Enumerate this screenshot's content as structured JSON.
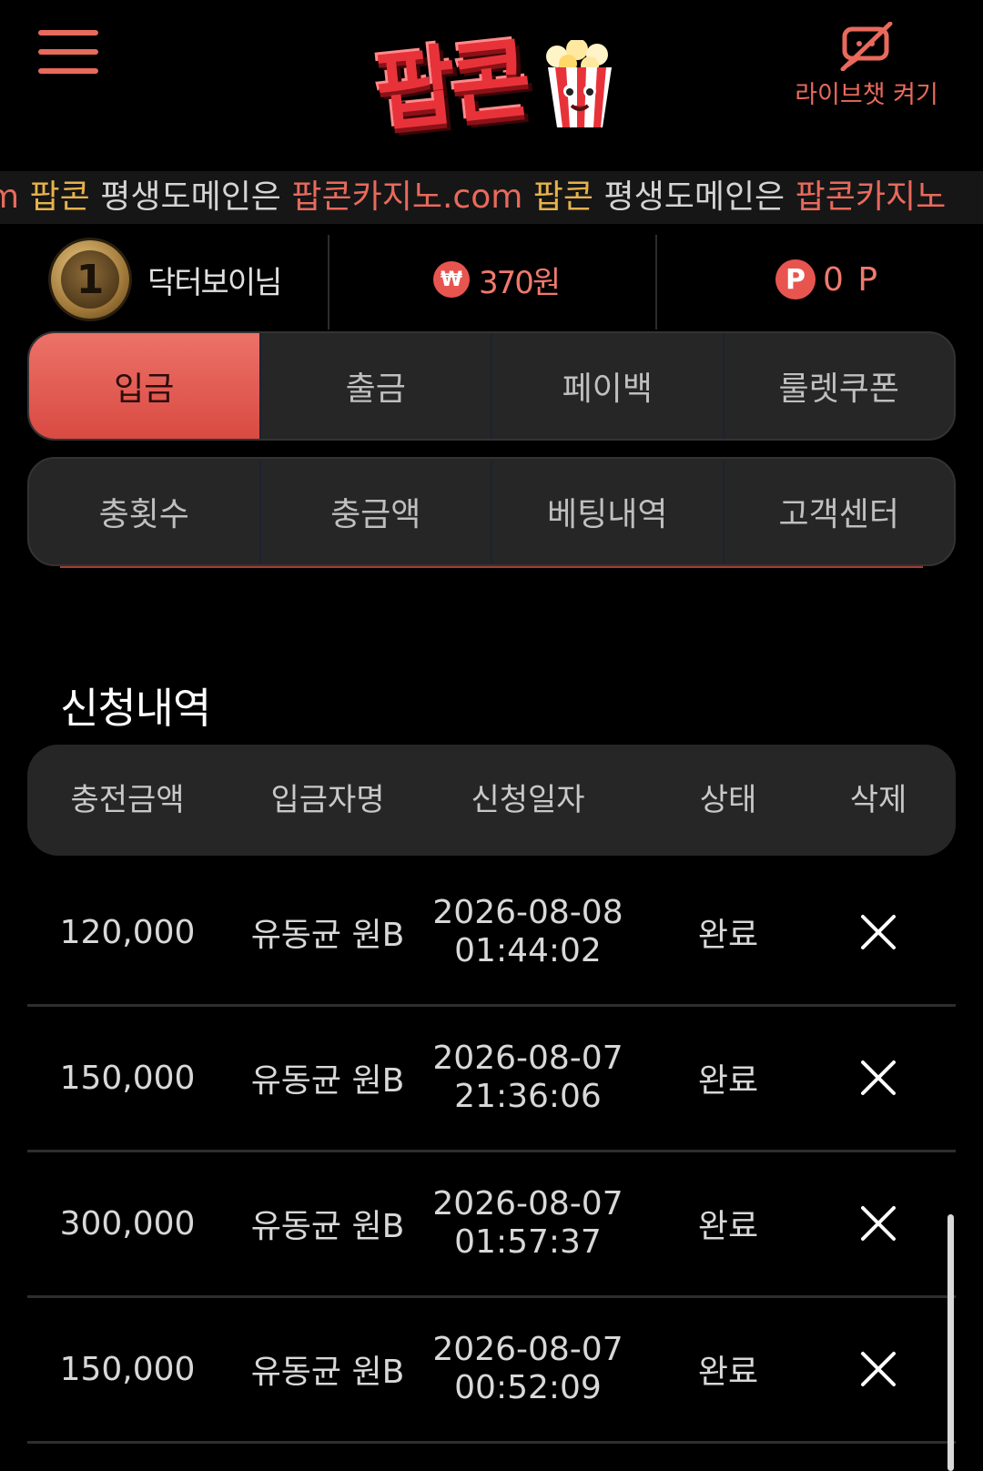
{
  "header": {
    "logo_text": "팝콘",
    "livechat_label": "라이브챗 켜기"
  },
  "marquee": {
    "segments": [
      {
        "text": "m ",
        "kind": "link"
      },
      {
        "text": "팝콘",
        "kind": "brand"
      },
      {
        "text": " 평생도메인은 ",
        "kind": "text"
      },
      {
        "text": "팝콘카지노.com",
        "kind": "link"
      },
      {
        "text": " ",
        "kind": "text"
      },
      {
        "text": "팝콘",
        "kind": "brand"
      },
      {
        "text": " 평생도메인은 ",
        "kind": "text"
      },
      {
        "text": "팝콘카지노",
        "kind": "link"
      }
    ]
  },
  "user": {
    "level": "1",
    "nickname": "닥터보이님",
    "currency_symbol": "₩",
    "balance": "370원",
    "point_symbol": "P",
    "points": "0 P"
  },
  "tabs_row1": [
    "입금",
    "출금",
    "페이백",
    "룰렛쿠폰"
  ],
  "tabs_row2": [
    "충횟수",
    "충금액",
    "베팅내역",
    "고객센터"
  ],
  "active_tab": "입금",
  "section_title": "신청내역",
  "table": {
    "headers": [
      "충전금액",
      "입금자명",
      "신청일자",
      "상태",
      "삭제"
    ],
    "rows": [
      {
        "amount": "120,000",
        "depositor": "유동균 원B",
        "date": "2026-08-08",
        "time": "01:44:02",
        "status": "완료"
      },
      {
        "amount": "150,000",
        "depositor": "유동균 원B",
        "date": "2026-08-07",
        "time": "21:36:06",
        "status": "완료"
      },
      {
        "amount": "300,000",
        "depositor": "유동균 원B",
        "date": "2026-08-07",
        "time": "01:57:37",
        "status": "완료"
      },
      {
        "amount": "150,000",
        "depositor": "유동균 원B",
        "date": "2026-08-07",
        "time": "00:52:09",
        "status": "완료"
      }
    ]
  },
  "colors": {
    "accent": "#e86a5c",
    "brand_gold": "#e6b14c",
    "background": "#000000",
    "panel": "#262626"
  },
  "icons": {
    "menu": "hamburger-icon",
    "livechat": "chat-off-icon",
    "level": "level-medal-icon",
    "currency": "won-icon",
    "point": "point-icon",
    "delete": "close-icon"
  }
}
